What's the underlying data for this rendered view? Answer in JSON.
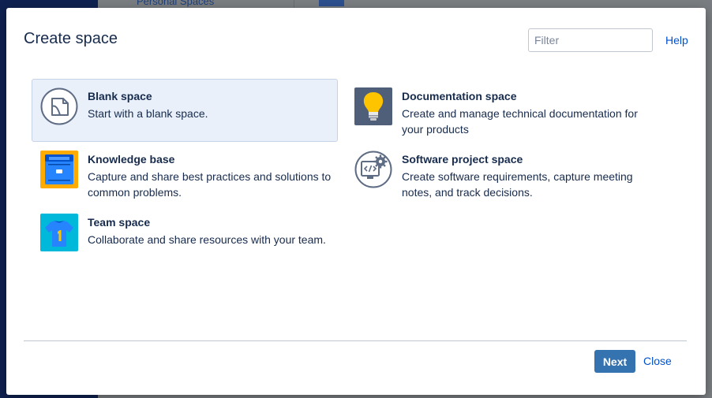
{
  "background": {
    "personal_spaces": "Personal Spaces"
  },
  "dialog": {
    "title": "Create space",
    "filter_placeholder": "Filter",
    "help_label": "Help",
    "next_label": "Next",
    "close_label": "Close"
  },
  "templates": [
    {
      "id": "blank",
      "name": "Blank space",
      "description": "Start with a blank space.",
      "icon": "blank-page-icon",
      "selected": true
    },
    {
      "id": "documentation",
      "name": "Documentation space",
      "description": "Create and manage technical documentation for your products",
      "icon": "lightbulb-icon",
      "selected": false
    },
    {
      "id": "knowledge",
      "name": "Knowledge base",
      "description": "Capture and share best practices and solutions to common problems.",
      "icon": "file-cabinet-icon",
      "selected": false
    },
    {
      "id": "software",
      "name": "Software project space",
      "description": "Create software requirements, capture meeting notes, and track decisions.",
      "icon": "code-gear-icon",
      "selected": false
    },
    {
      "id": "team",
      "name": "Team space",
      "description": "Collaborate and share resources with your team.",
      "icon": "team-jersey-icon",
      "selected": false
    }
  ],
  "colors": {
    "accent": "#3572b0",
    "link": "#0052cc",
    "text": "#172b4d",
    "selected_bg": "#e9f0fa"
  }
}
